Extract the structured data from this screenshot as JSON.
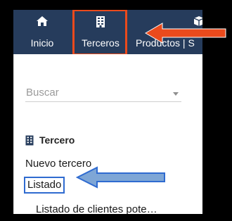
{
  "nav": {
    "items": [
      {
        "label": "Inicio",
        "icon": "home-icon"
      },
      {
        "label": "Terceros",
        "icon": "building-icon"
      },
      {
        "label": "Productos | S",
        "icon": "box-icon"
      }
    ]
  },
  "sidebar": {
    "search_placeholder": "Buscar",
    "section_title": "Tercero",
    "section_icon": "building-icon",
    "links": [
      "Nuevo tercero",
      "Listado",
      "Listado de clientes pote…"
    ]
  },
  "colors": {
    "topbar": "#263c5c",
    "highlight_orange": "#ea4a1c",
    "highlight_blue": "#2f6bd0",
    "arrow_blue_fill": "#7ea6d6"
  }
}
